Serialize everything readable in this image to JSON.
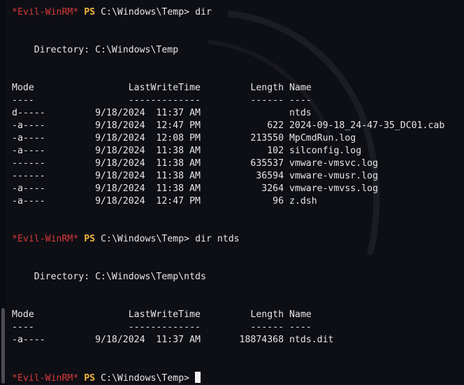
{
  "colors": {
    "background": "#0e0f15",
    "text": "#e6e6e6",
    "prompt_user": "#d7393a",
    "prompt_ps": "#f3b63a"
  },
  "prompt": {
    "user": "*Evil-WinRM*",
    "ps": "PS",
    "path": "C:\\Windows\\Temp>"
  },
  "commands": [
    "dir",
    "dir ntds"
  ],
  "listing1": {
    "directory": "    Directory: C:\\Windows\\Temp",
    "header": "Mode                 LastWriteTime         Length Name",
    "separator": "----                 -------------         ------ ----",
    "rows": [
      "d-----         9/18/2024  11:37 AM                ntds",
      "-a----         9/18/2024  12:47 PM            622 2024-09-18_24-47-35_DC01.cab",
      "-a----         9/18/2024  12:08 PM         213550 MpCmdRun.log",
      "-a----         9/18/2024  11:38 AM            102 silconfig.log",
      "------         9/18/2024  11:38 AM         635537 vmware-vmsvc.log",
      "------         9/18/2024  11:38 AM          36594 vmware-vmusr.log",
      "-a----         9/18/2024  11:38 AM           3264 vmware-vmvss.log",
      "-a----         9/18/2024  12:47 PM             96 z.dsh"
    ]
  },
  "listing2": {
    "directory": "    Directory: C:\\Windows\\Temp\\ntds",
    "header": "Mode                 LastWriteTime         Length Name",
    "separator": "----                 -------------         ------ ----",
    "rows": [
      "-a----         9/18/2024  11:37 AM       18874368 ntds.dit"
    ]
  }
}
